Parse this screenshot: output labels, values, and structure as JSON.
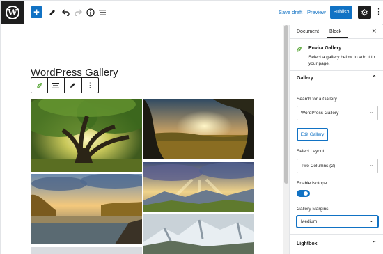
{
  "topbar": {
    "logo_letter": "W",
    "add_label": "+",
    "save_draft": "Save draft",
    "preview": "Preview",
    "publish": "Publish"
  },
  "editor": {
    "page_title": "WordPress Gallery",
    "toolbar": [
      "envira-leaf-icon",
      "align-icon",
      "edit-pencil-icon",
      "more-vertical-icon"
    ]
  },
  "sidebar": {
    "tabs": [
      "Document",
      "Block"
    ],
    "active_tab": "Block",
    "block_name": "Envira Gallery",
    "block_desc": "Select a gallery below to add it to your page.",
    "gallery_panel": "Gallery",
    "search_label": "Search for a Gallery",
    "search_value": "WordPress Gallery",
    "edit_gallery": "Edit Gallery",
    "layout_label": "Select Layout",
    "layout_value": "Two Columns (2)",
    "isotope_label": "Enable Isotope",
    "isotope_on": true,
    "margins_label": "Gallery Margins",
    "margins_value": "Medium",
    "lightbox_panel": "Lightbox"
  },
  "colors": {
    "accent": "#1172c4",
    "dark": "#1e1e1e",
    "leaf": "#6ab04c"
  }
}
